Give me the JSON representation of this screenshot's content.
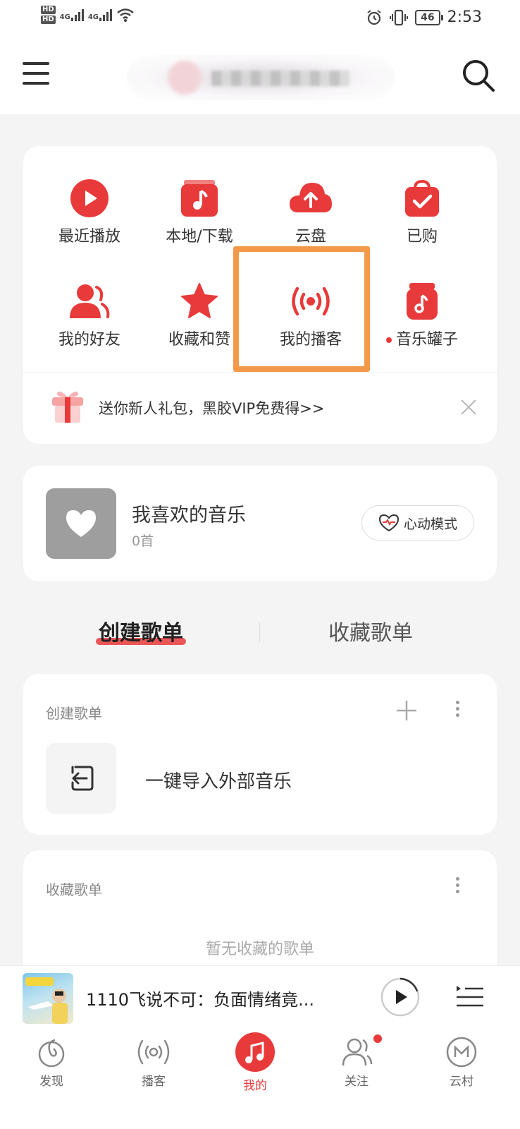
{
  "status_bar": {
    "hd1": "HD",
    "hd2": "HD",
    "net1": "4G",
    "net2": "4G",
    "battery": "46",
    "time": "2:53"
  },
  "shortcuts": [
    {
      "label": "最近播放",
      "icon": "play-circle-icon"
    },
    {
      "label": "本地/下载",
      "icon": "music-note-box-icon"
    },
    {
      "label": "云盘",
      "icon": "cloud-upload-icon"
    },
    {
      "label": "已购",
      "icon": "shopping-bag-check-icon"
    },
    {
      "label": "我的好友",
      "icon": "friends-icon"
    },
    {
      "label": "收藏和赞",
      "icon": "star-icon"
    },
    {
      "label": "我的播客",
      "icon": "podcast-broadcast-icon"
    },
    {
      "label": "音乐罐子",
      "icon": "music-jar-icon"
    }
  ],
  "promo": {
    "text": "送你新人礼包，黑胶VIP免费得>>"
  },
  "favorites": {
    "title": "我喜欢的音乐",
    "count": "0首",
    "mode_button": "心动模式"
  },
  "tabs": {
    "created": "创建歌单",
    "collected": "收藏歌单"
  },
  "created_section": {
    "title": "创建歌单",
    "import_label": "一键导入外部音乐"
  },
  "collected_section": {
    "title": "收藏歌单",
    "empty_text": "暂无收藏的歌单"
  },
  "player": {
    "title": "1110飞说不可：负面情绪竟..."
  },
  "nav": [
    {
      "label": "发现"
    },
    {
      "label": "播客"
    },
    {
      "label": "我的"
    },
    {
      "label": "关注"
    },
    {
      "label": "云村"
    }
  ],
  "colors": {
    "brand_red": "#e83a3a",
    "highlight_orange": "#f39a4a",
    "background": "#f4f4f4"
  }
}
